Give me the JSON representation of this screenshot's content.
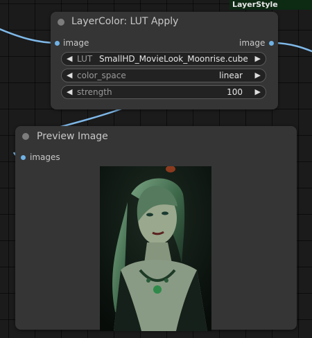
{
  "badge": {
    "label": "LayerStyle"
  },
  "lut_node": {
    "title": "LayerColor: LUT Apply",
    "input_label": "image",
    "output_label": "image",
    "widgets": [
      {
        "name": "LUT",
        "value": "SmallHD_MovieLook_Moonrise.cube"
      },
      {
        "name": "color_space",
        "value": "linear"
      },
      {
        "name": "strength",
        "value": "100"
      }
    ]
  },
  "preview_node": {
    "title": "Preview Image",
    "input_label": "images",
    "image_description": ""
  },
  "colors": {
    "canvas": "#1b1b1b",
    "node_bg": "#353535",
    "socket": "#6fb2e6",
    "link": "#7fb9ea",
    "badge_bg": "#0d2a13"
  }
}
